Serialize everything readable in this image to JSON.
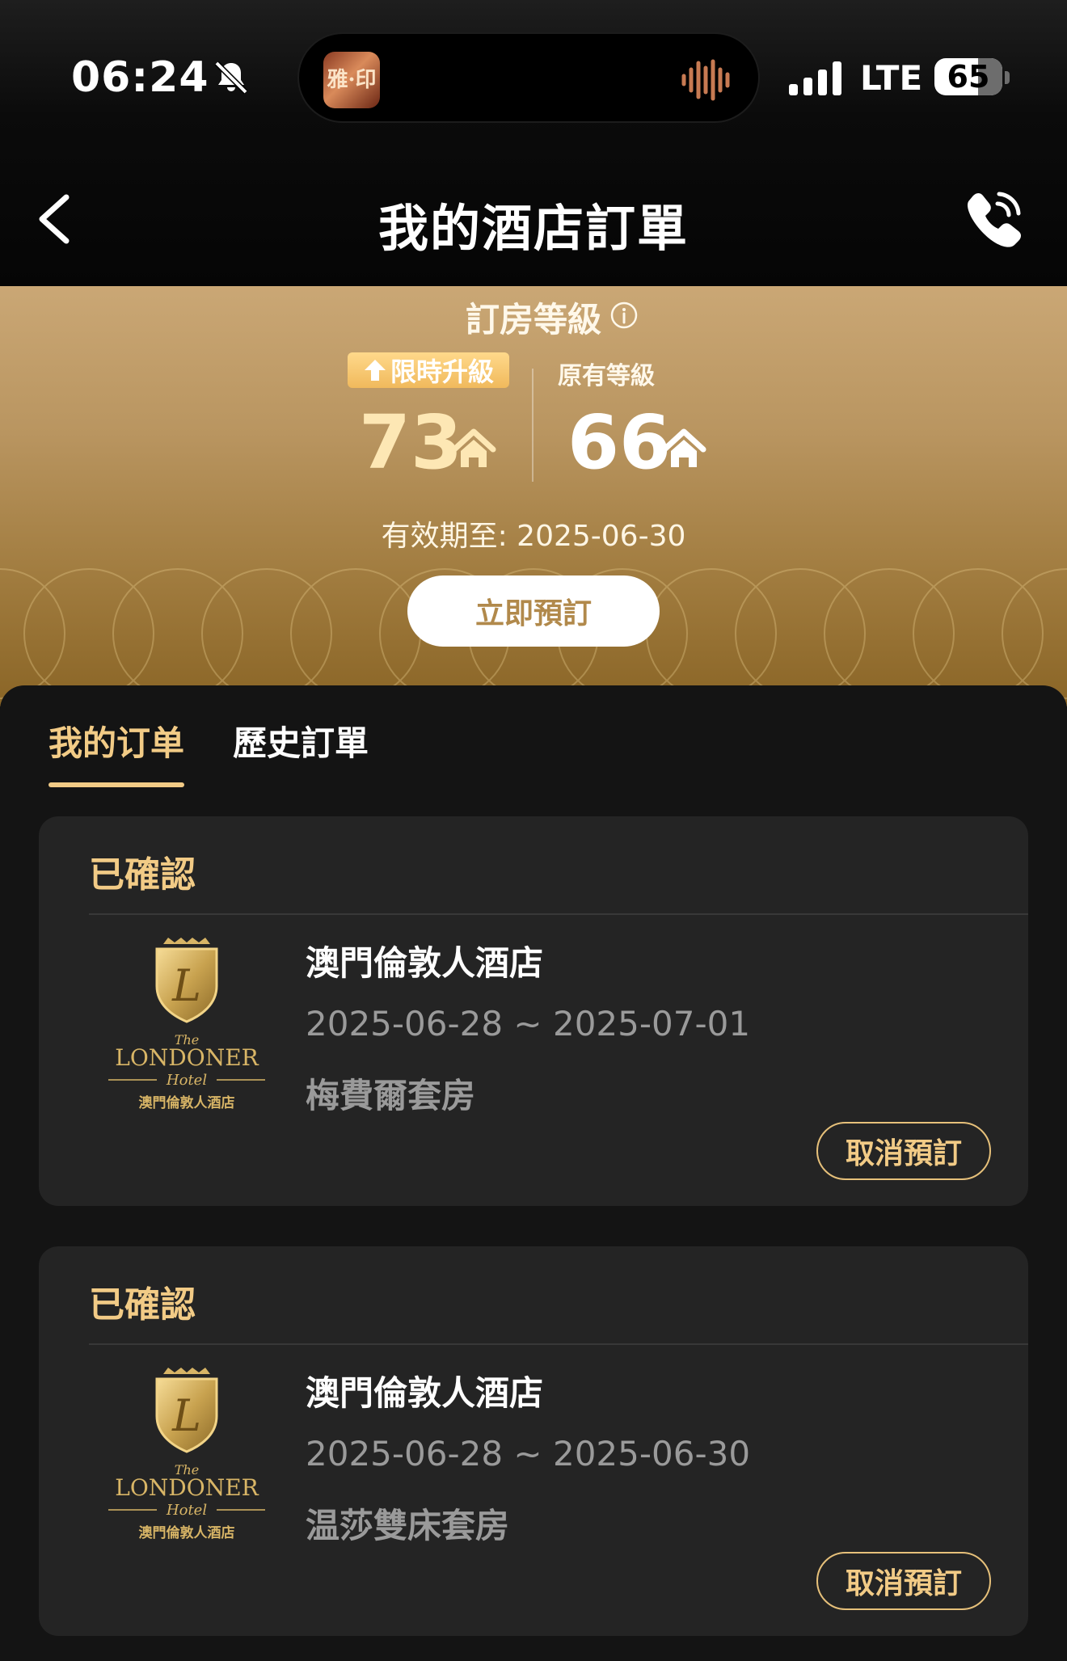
{
  "status_bar": {
    "time": "06:24",
    "network": "LTE",
    "battery": "65",
    "silent_icon": "bell-slash-icon",
    "now_playing_art_text": "雅·印"
  },
  "nav": {
    "title": "我的酒店訂單",
    "back_icon": "chevron-left-icon",
    "phone_icon": "phone-call-icon"
  },
  "tier": {
    "title": "訂房等級",
    "upgrade_badge": "限時升級",
    "upgrade_level": "73",
    "original_label": "原有等級",
    "original_level": "66",
    "validity": "有效期至: 2025-06-30",
    "book_button": "立即預訂"
  },
  "tabs": [
    {
      "label": "我的订单",
      "active": true
    },
    {
      "label": "歷史訂單",
      "active": false
    }
  ],
  "orders": [
    {
      "status": "已確認",
      "hotel": "澳門倫敦人酒店",
      "dates": "2025-06-28 ~ 2025-07-01",
      "room": "梅費爾套房",
      "cancel": "取消預訂",
      "logo": {
        "the": "The",
        "brand": "LONDONER",
        "hotel": "Hotel",
        "cn": "澳門倫敦人酒店"
      }
    },
    {
      "status": "已確認",
      "hotel": "澳門倫敦人酒店",
      "dates": "2025-06-28 ~ 2025-06-30",
      "room": "温莎雙床套房",
      "cancel": "取消預訂",
      "logo": {
        "the": "The",
        "brand": "LONDONER",
        "hotel": "Hotel",
        "cn": "澳門倫敦人酒店"
      }
    }
  ],
  "colors": {
    "accent_gold": "#f2cb86",
    "card_bg": "#242424",
    "page_bg": "#141414"
  }
}
